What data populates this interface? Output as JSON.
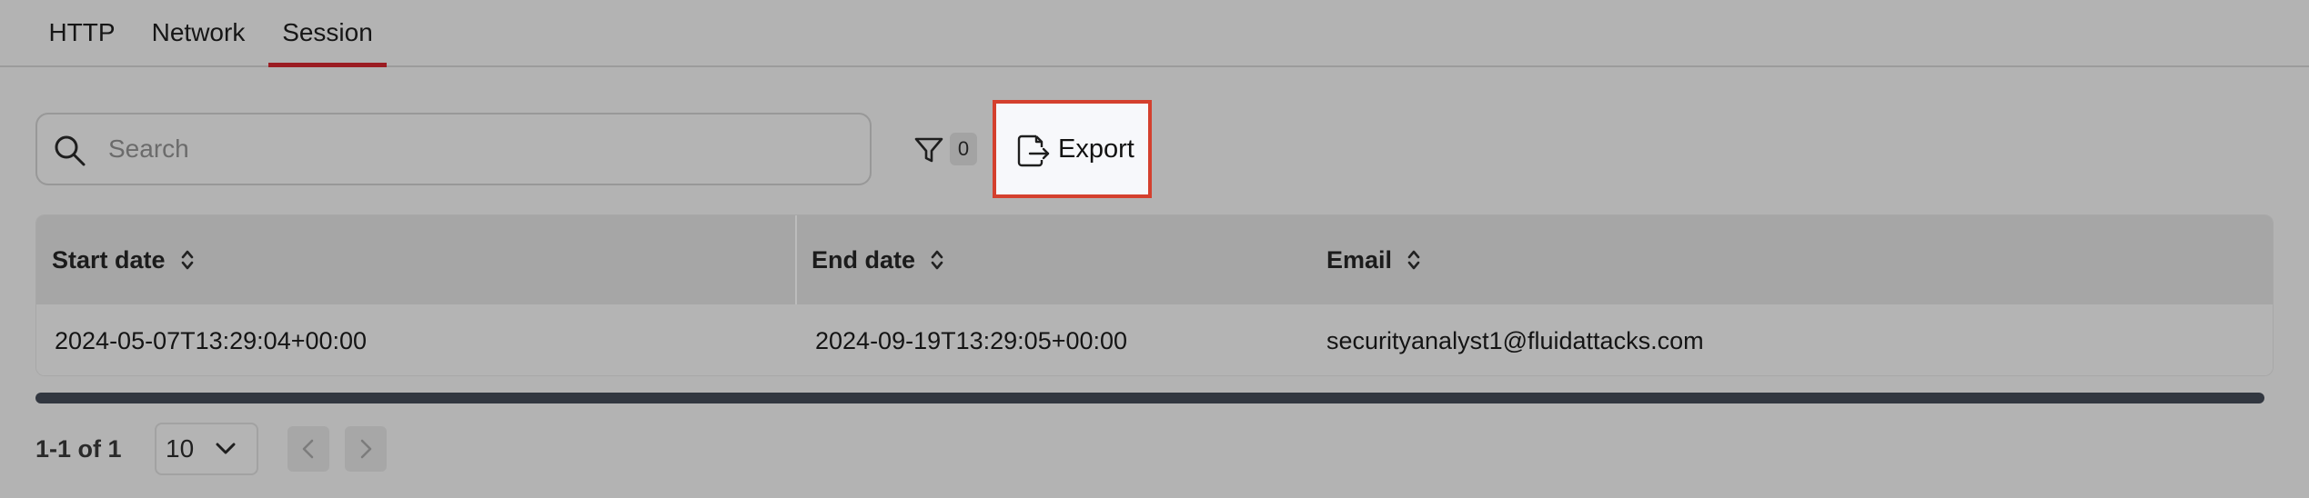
{
  "tabs": [
    {
      "label": "HTTP",
      "active": false
    },
    {
      "label": "Network",
      "active": false
    },
    {
      "label": "Session",
      "active": true
    }
  ],
  "search": {
    "placeholder": "Search",
    "value": "",
    "icon": "search-icon"
  },
  "filter": {
    "icon": "filter-icon",
    "count": "0"
  },
  "export": {
    "label": "Export",
    "icon": "file-export-icon",
    "highlight_color": "#d4402e"
  },
  "table": {
    "columns": [
      {
        "label": "Start date",
        "sortable": true
      },
      {
        "label": "End date",
        "sortable": true
      },
      {
        "label": "Email",
        "sortable": true
      }
    ],
    "rows": [
      [
        "2024-05-07T13:29:04+00:00",
        "2024-09-19T13:29:05+00:00",
        "securityanalyst1@fluidattacks.com"
      ]
    ]
  },
  "pagination": {
    "range_text": "1-1 of 1",
    "page_size": "10",
    "prev_icon": "chevron-left-icon",
    "next_icon": "chevron-right-icon"
  },
  "colors": {
    "active_tab_underline": "#9b1c22",
    "overlay_background": "#b3b3b3",
    "scrollbar": "#323740"
  }
}
